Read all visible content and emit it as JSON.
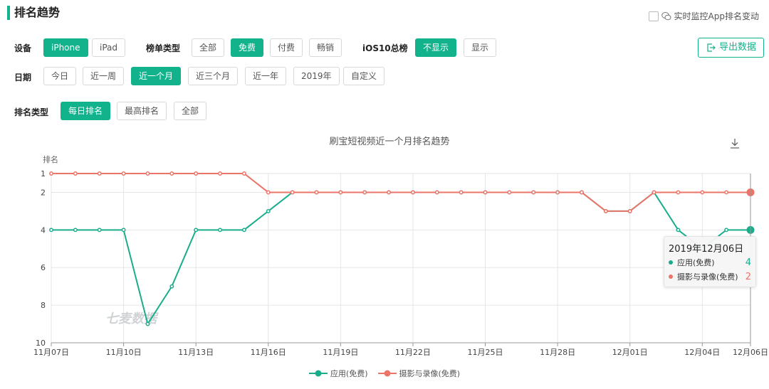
{
  "header": {
    "title": "排名趋势",
    "monitor_label": "实时监控App排名变动"
  },
  "filters": {
    "device_label": "设备",
    "device_options": [
      "iPhone",
      "iPad"
    ],
    "list_type_label": "榜单类型",
    "list_type_options": [
      "全部",
      "免费",
      "付费",
      "畅销"
    ],
    "ios10_label": "iOS10总榜",
    "ios10_options": [
      "不显示",
      "显示"
    ],
    "date_label": "日期",
    "date_options": [
      "今日",
      "近一周",
      "近一个月",
      "近三个月",
      "近一年",
      "2019年",
      "自定义"
    ],
    "rank_type_label": "排名类型",
    "rank_type_options": [
      "每日排名",
      "最高排名",
      "全部"
    ],
    "export_label": "导出数据"
  },
  "colors": {
    "accent": "#12b28c",
    "series_app": "#1aad8c",
    "series_cat": "#ec7468"
  },
  "chart_data": {
    "type": "line",
    "title": "刷宝短视频近一个月排名趋势",
    "ylabel": "排名",
    "xlabel": "",
    "ylim": [
      1,
      10
    ],
    "y_inverted": true,
    "y_ticks": [
      "1",
      "2",
      "4",
      "6",
      "8",
      "10"
    ],
    "x_tick_labels": [
      "11月07日",
      "11月10日",
      "11月13日",
      "11月16日",
      "11月19日",
      "11月22日",
      "11月25日",
      "11月28日",
      "12月01日",
      "12月04日",
      "12月06日"
    ],
    "x": [
      "11-07",
      "11-08",
      "11-09",
      "11-10",
      "11-11",
      "11-12",
      "11-13",
      "11-14",
      "11-15",
      "11-16",
      "11-17",
      "11-18",
      "11-19",
      "11-20",
      "11-21",
      "11-22",
      "11-23",
      "11-24",
      "11-25",
      "11-26",
      "11-27",
      "11-28",
      "11-29",
      "11-30",
      "12-01",
      "12-02",
      "12-03",
      "12-04",
      "12-05",
      "12-06"
    ],
    "series": [
      {
        "name": "应用(免费)",
        "values": [
          4,
          4,
          4,
          4,
          9,
          7,
          4,
          4,
          4,
          3,
          2,
          2,
          2,
          2,
          2,
          2,
          2,
          2,
          2,
          2,
          2,
          2,
          2,
          3,
          3,
          2,
          4,
          5,
          4,
          4
        ]
      },
      {
        "name": "摄影与录像(免费)",
        "values": [
          1,
          1,
          1,
          1,
          1,
          1,
          1,
          1,
          1,
          2,
          2,
          2,
          2,
          2,
          2,
          2,
          2,
          2,
          2,
          2,
          2,
          2,
          2,
          3,
          3,
          2,
          2,
          2,
          2,
          2
        ]
      }
    ],
    "grid": true,
    "legend": "bottom-center",
    "watermark": "七麦数据",
    "tooltip": {
      "date": "2019年12月06日",
      "rows": [
        {
          "name": "应用(免费)",
          "value": "4"
        },
        {
          "name": "摄影与录像(免费)",
          "value": "2"
        }
      ]
    }
  }
}
